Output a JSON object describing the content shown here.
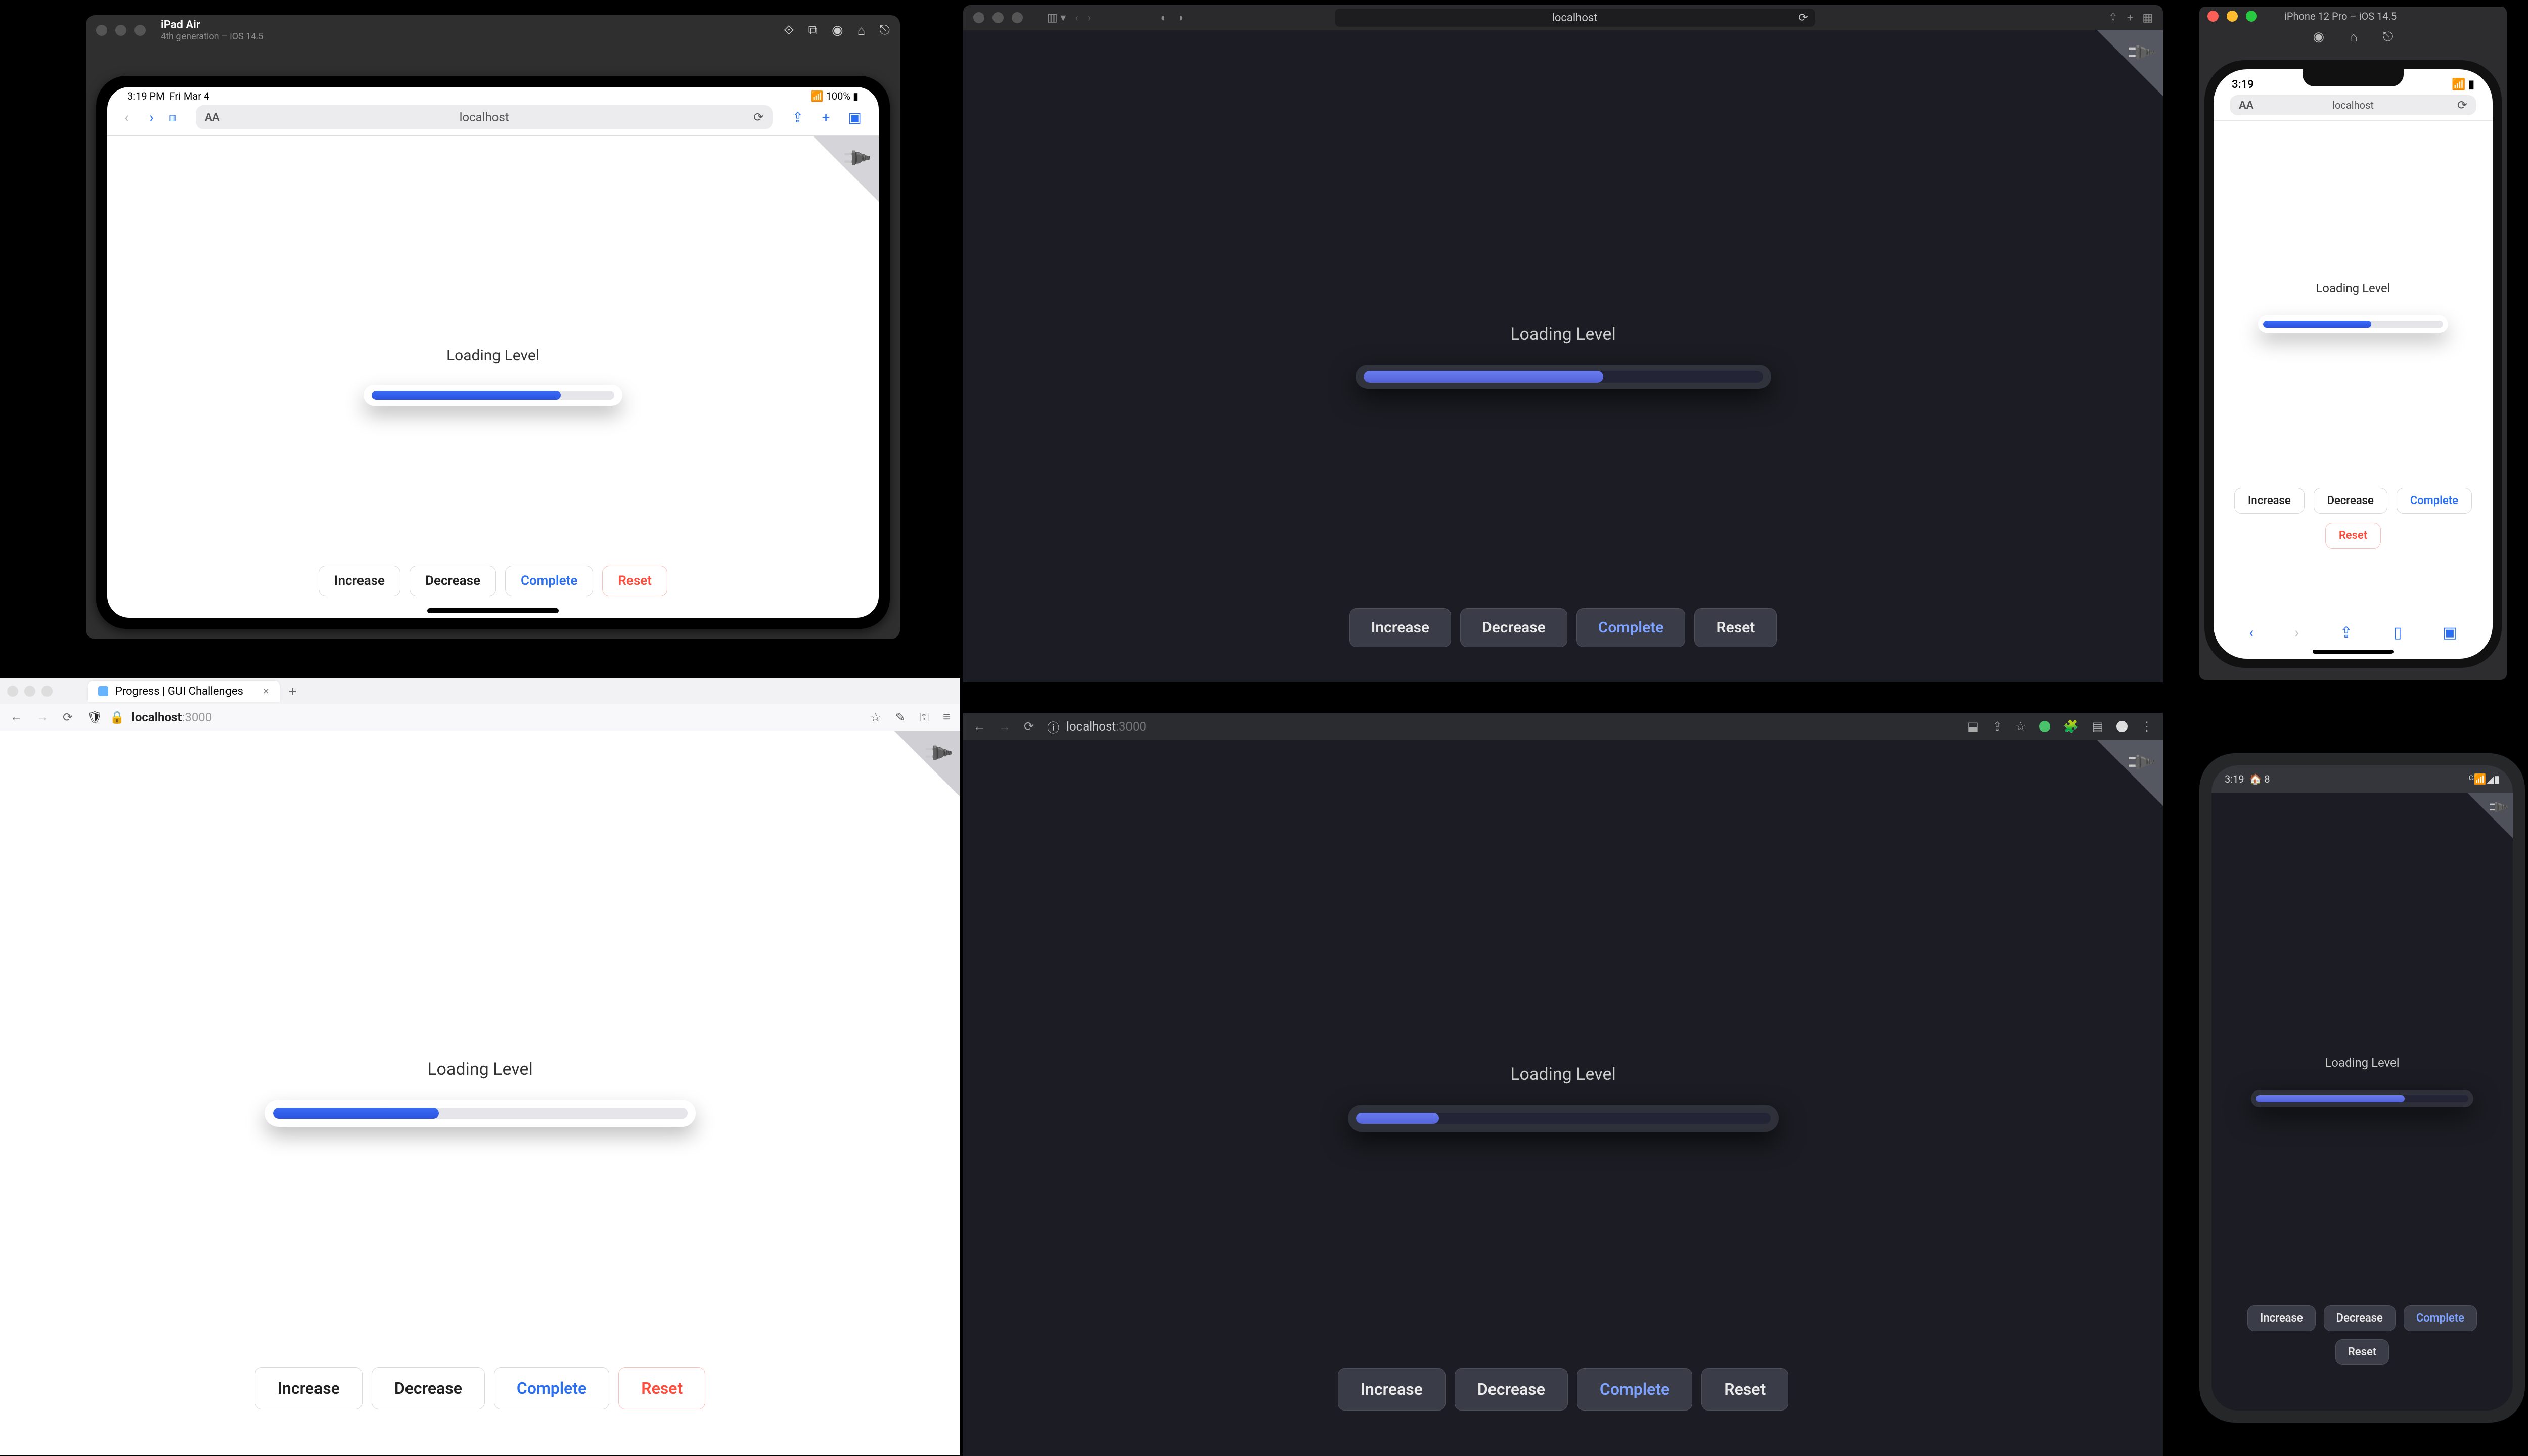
{
  "app": {
    "loading_label": "Loading Level",
    "buttons": {
      "increase": "Increase",
      "decrease": "Decrease",
      "complete": "Complete",
      "reset": "Reset"
    }
  },
  "progress": {
    "ipad_pct": 78,
    "safari_pct": 60,
    "firefox_pct": 40,
    "chrome_pct": 20,
    "iphone_pct": 60,
    "android_pct": 70
  },
  "ipad": {
    "title": "iPad Air",
    "subtitle": "4th generation – iOS 14.5",
    "status": {
      "time": "3:19 PM",
      "date": "Fri Mar 4",
      "battery": "100%"
    },
    "address": "localhost",
    "aa": "AA"
  },
  "safari": {
    "address": "localhost"
  },
  "iphone": {
    "title": "iPhone 12 Pro – iOS 14.5",
    "time": "3:19",
    "address": "localhost",
    "aa": "AA"
  },
  "firefox": {
    "tab_title": "Progress | GUI Challenges",
    "host": "localhost",
    "port": ":3000"
  },
  "chrome": {
    "host": "localhost",
    "port": ":3000"
  },
  "android": {
    "time": "3:19",
    "temp": "8"
  },
  "colors": {
    "blue": "#2a6ff3",
    "red": "#ff4d3d",
    "dark_bg": "#1c1d24"
  }
}
